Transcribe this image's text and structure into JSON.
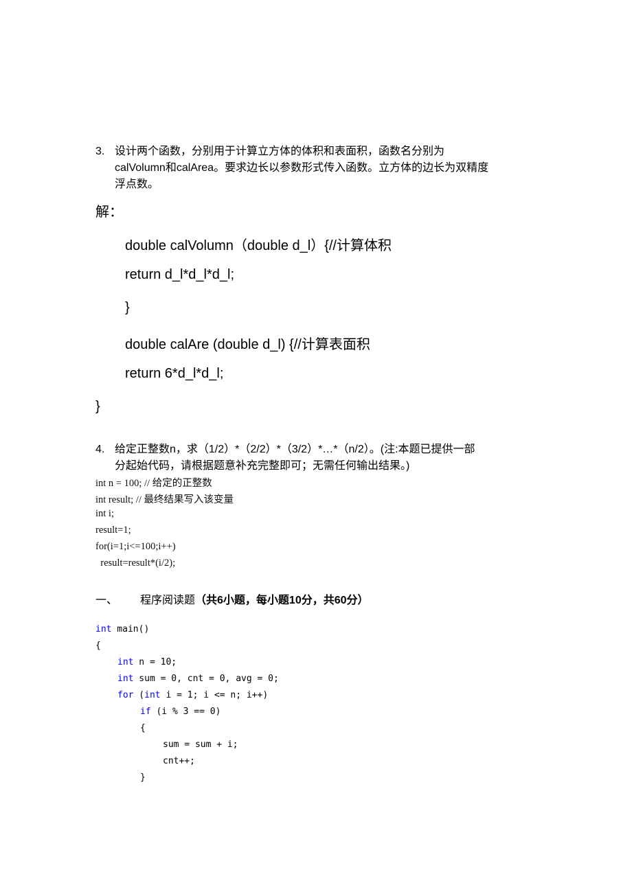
{
  "question3": {
    "number": "3.",
    "lines": [
      "设计两个函数，分别用于计算立方体的体积和表面积，函数名分别为",
      "calVolumn和calArea。要求边长以参数形式传入函数。立方体的边长为双精度",
      "浮点数。"
    ],
    "answer_label": "解：",
    "code": [
      "double calVolumn（double d_l）{//计算体积",
      "return d_l*d_l*d_l;",
      "}",
      "double calAre (double d_l) {//计算表面积",
      "return 6*d_l*d_l;",
      "}"
    ]
  },
  "question4": {
    "number": "4.",
    "lines": [
      "给定正整数n，求（1/2）*（2/2）*（3/2）*…*（n/2）。(注:本题已提供一部",
      "分起始代码，请根据题意补充完整即可；无需任何输出结果。)"
    ],
    "code": [
      "int n = 100; // 给定的正整数",
      "int result; // 最终结果写入该变量",
      "int i;",
      "result=1;",
      "for(i=1;i<=100;i++)",
      "  result=result*(i/2);"
    ]
  },
  "section": {
    "number": "一、",
    "title_plain": "程序阅读题",
    "title_bold": "（共6小题，每小题10分，共60分）"
  },
  "program": {
    "keyword_color": "#0000ff",
    "lines": [
      {
        "kw": "int",
        "rest": " main()"
      },
      {
        "kw": "",
        "rest": "{"
      },
      {
        "kw": "int",
        "rest": " n = 10;"
      },
      {
        "kw": "int",
        "rest": " sum = 0, cnt = 0, avg = 0;"
      },
      {
        "kw": "for",
        "rest": " (",
        "kw2": "int",
        "rest2": " i = 1; i <= n; i++)"
      },
      {
        "kw": "if",
        "rest": " (i % 3 == 0)"
      },
      {
        "kw": "",
        "rest": "{"
      },
      {
        "kw": "",
        "rest": "sum = sum + i;"
      },
      {
        "kw": "",
        "rest": "cnt++;"
      },
      {
        "kw": "",
        "rest": "}"
      }
    ]
  }
}
